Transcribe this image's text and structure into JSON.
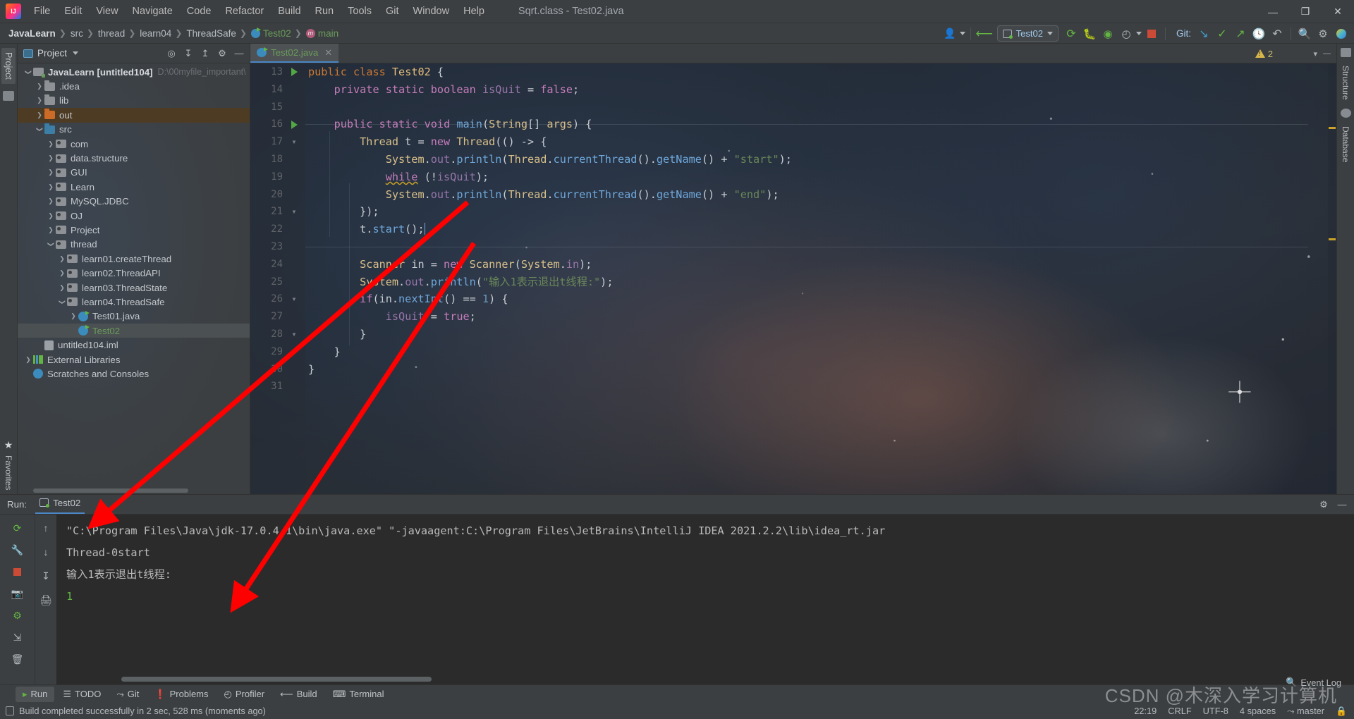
{
  "titlebar": {
    "app_icon": "intellij-logo",
    "menus": [
      "File",
      "Edit",
      "View",
      "Navigate",
      "Code",
      "Refactor",
      "Build",
      "Run",
      "Tools",
      "Git",
      "Window",
      "Help"
    ],
    "window_title": "Sqrt.class - Test02.java",
    "minimize": "—",
    "maximize": "❐",
    "close": "✕"
  },
  "navbar": {
    "breadcrumbs": [
      {
        "label": "JavaLearn",
        "style": "bold"
      },
      {
        "label": "src",
        "style": "plain"
      },
      {
        "label": "thread",
        "style": "plain"
      },
      {
        "label": "learn04",
        "style": "plain"
      },
      {
        "label": "ThreadSafe",
        "style": "plain"
      },
      {
        "label": "Test02",
        "style": "green",
        "icon": "java-class-icon"
      },
      {
        "label": "main",
        "style": "green",
        "icon": "java-method-icon"
      }
    ],
    "separator": "❯",
    "run_config": "Test02",
    "git_label": "Git:",
    "icons": [
      "user-icon",
      "hammer-icon",
      "rerun-icon",
      "debug-icon",
      "coverage-icon",
      "profiler-icon",
      "update-project-icon",
      "commit-icon",
      "push-icon",
      "history-icon",
      "undo-icon",
      "search-icon",
      "settings-icon"
    ]
  },
  "left_rail": {
    "project_tab": "Project",
    "favorites_tab": "Favorites"
  },
  "right_rail": {
    "tabs": [
      "Structure",
      "Database"
    ]
  },
  "project_panel": {
    "header_title": "Project",
    "header_icons": [
      "locate-icon",
      "expand-all-icon",
      "collapse-all-icon",
      "settings-icon",
      "hide-icon"
    ],
    "tree": [
      {
        "depth": 0,
        "arrow": "down",
        "icon": "module-folder",
        "label": "JavaLearn [untitled104]",
        "bold": true,
        "path": "D:\\00myfile_important\\",
        "state": "normal"
      },
      {
        "depth": 1,
        "arrow": "right",
        "icon": "folder-grey",
        "label": ".idea",
        "state": "normal"
      },
      {
        "depth": 1,
        "arrow": "right",
        "icon": "folder-grey",
        "label": "lib",
        "state": "normal"
      },
      {
        "depth": 1,
        "arrow": "right",
        "icon": "folder-orange",
        "label": "out",
        "state": "selected-orange"
      },
      {
        "depth": 1,
        "arrow": "down",
        "icon": "folder-blue",
        "label": "src",
        "state": "normal"
      },
      {
        "depth": 2,
        "arrow": "right",
        "icon": "package",
        "label": "com",
        "state": "normal"
      },
      {
        "depth": 2,
        "arrow": "right",
        "icon": "package",
        "label": "data.structure",
        "state": "normal"
      },
      {
        "depth": 2,
        "arrow": "right",
        "icon": "package",
        "label": "GUI",
        "state": "normal"
      },
      {
        "depth": 2,
        "arrow": "right",
        "icon": "package",
        "label": "Learn",
        "state": "normal"
      },
      {
        "depth": 2,
        "arrow": "right",
        "icon": "package",
        "label": "MySQL.JDBC",
        "state": "normal"
      },
      {
        "depth": 2,
        "arrow": "right",
        "icon": "package",
        "label": "OJ",
        "state": "normal"
      },
      {
        "depth": 2,
        "arrow": "right",
        "icon": "package",
        "label": "Project",
        "state": "normal"
      },
      {
        "depth": 2,
        "arrow": "down",
        "icon": "package",
        "label": "thread",
        "state": "normal"
      },
      {
        "depth": 3,
        "arrow": "right",
        "icon": "package",
        "label": "learn01.createThread",
        "state": "normal"
      },
      {
        "depth": 3,
        "arrow": "right",
        "icon": "package",
        "label": "learn02.ThreadAPI",
        "state": "normal"
      },
      {
        "depth": 3,
        "arrow": "right",
        "icon": "package",
        "label": "learn03.ThreadState",
        "state": "normal"
      },
      {
        "depth": 3,
        "arrow": "down",
        "icon": "package",
        "label": "learn04.ThreadSafe",
        "state": "normal"
      },
      {
        "depth": 4,
        "arrow": "right",
        "icon": "java-class-icon",
        "label": "Test01.java",
        "state": "normal"
      },
      {
        "depth": 4,
        "arrow": "none",
        "icon": "java-class-icon",
        "label": "Test02",
        "green": true,
        "state": "selected-grey"
      },
      {
        "depth": 1,
        "arrow": "none",
        "icon": "iml-file",
        "label": "untitled104.iml",
        "state": "normal"
      },
      {
        "depth": 0,
        "arrow": "right",
        "icon": "library-icon",
        "label": "External Libraries",
        "state": "normal"
      },
      {
        "depth": 0,
        "arrow": "none",
        "icon": "scratches-icon",
        "label": "Scratches and Consoles",
        "state": "normal"
      }
    ]
  },
  "editor": {
    "tab": {
      "label": "Test02.java",
      "close": "✕",
      "icon": "java-class-icon"
    },
    "warning_count": "2",
    "lines": [
      {
        "num": "13",
        "gutter": "run",
        "fold": "",
        "tokens": [
          {
            "t": "public",
            "c": "kw"
          },
          {
            "t": " ",
            "c": "pln"
          },
          {
            "t": "class",
            "c": "kw"
          },
          {
            "t": " ",
            "c": "pln"
          },
          {
            "t": "Test02",
            "c": "cls"
          },
          {
            "t": " {",
            "c": "pln"
          }
        ]
      },
      {
        "num": "14",
        "gutter": "",
        "fold": "",
        "tokens": [
          {
            "t": "    ",
            "c": "pln"
          },
          {
            "t": "private",
            "c": "kwp"
          },
          {
            "t": " ",
            "c": "pln"
          },
          {
            "t": "static",
            "c": "kwp"
          },
          {
            "t": " ",
            "c": "pln"
          },
          {
            "t": "boolean",
            "c": "kwp"
          },
          {
            "t": " ",
            "c": "pln"
          },
          {
            "t": "isQuit",
            "c": "var"
          },
          {
            "t": " = ",
            "c": "pln"
          },
          {
            "t": "false",
            "c": "kwp"
          },
          {
            "t": ";",
            "c": "pln"
          }
        ]
      },
      {
        "num": "15",
        "gutter": "",
        "fold": "",
        "tokens": []
      },
      {
        "num": "16",
        "gutter": "run",
        "fold": "fold",
        "tokens": [
          {
            "t": "    ",
            "c": "pln"
          },
          {
            "t": "public",
            "c": "kwp"
          },
          {
            "t": " ",
            "c": "pln"
          },
          {
            "t": "static",
            "c": "kwp"
          },
          {
            "t": " ",
            "c": "pln"
          },
          {
            "t": "void",
            "c": "kwp"
          },
          {
            "t": " ",
            "c": "pln"
          },
          {
            "t": "main",
            "c": "mth"
          },
          {
            "t": "(",
            "c": "pln"
          },
          {
            "t": "String",
            "c": "typ"
          },
          {
            "t": "[] ",
            "c": "pln"
          },
          {
            "t": "args",
            "c": "typ"
          },
          {
            "t": ") {",
            "c": "pln"
          }
        ]
      },
      {
        "num": "17",
        "gutter": "",
        "fold": "fold",
        "tokens": [
          {
            "t": "        ",
            "c": "pln"
          },
          {
            "t": "Thread",
            "c": "typ"
          },
          {
            "t": " t = ",
            "c": "pln"
          },
          {
            "t": "new",
            "c": "kwp"
          },
          {
            "t": " ",
            "c": "pln"
          },
          {
            "t": "Thread",
            "c": "typ"
          },
          {
            "t": "(() -> {",
            "c": "pln"
          }
        ]
      },
      {
        "num": "18",
        "gutter": "",
        "fold": "",
        "tokens": [
          {
            "t": "            ",
            "c": "pln"
          },
          {
            "t": "System",
            "c": "typ"
          },
          {
            "t": ".",
            "c": "pln"
          },
          {
            "t": "out",
            "c": "fld"
          },
          {
            "t": ".",
            "c": "pln"
          },
          {
            "t": "println",
            "c": "mth"
          },
          {
            "t": "(",
            "c": "pln"
          },
          {
            "t": "Thread",
            "c": "typ"
          },
          {
            "t": ".",
            "c": "pln"
          },
          {
            "t": "currentThread",
            "c": "mth"
          },
          {
            "t": "().",
            "c": "pln"
          },
          {
            "t": "getName",
            "c": "mth"
          },
          {
            "t": "() + ",
            "c": "pln"
          },
          {
            "t": "\"start\"",
            "c": "str"
          },
          {
            "t": ");",
            "c": "pln"
          }
        ]
      },
      {
        "num": "19",
        "gutter": "",
        "fold": "",
        "tokens": [
          {
            "t": "            ",
            "c": "pln"
          },
          {
            "t": "while",
            "c": "kwp sq"
          },
          {
            "t": " (!",
            "c": "pln"
          },
          {
            "t": "isQuit",
            "c": "var"
          },
          {
            "t": ");",
            "c": "pln"
          }
        ]
      },
      {
        "num": "20",
        "gutter": "",
        "fold": "",
        "tokens": [
          {
            "t": "            ",
            "c": "pln"
          },
          {
            "t": "System",
            "c": "typ"
          },
          {
            "t": ".",
            "c": "pln"
          },
          {
            "t": "out",
            "c": "fld"
          },
          {
            "t": ".",
            "c": "pln"
          },
          {
            "t": "println",
            "c": "mth"
          },
          {
            "t": "(",
            "c": "pln"
          },
          {
            "t": "Thread",
            "c": "typ"
          },
          {
            "t": ".",
            "c": "pln"
          },
          {
            "t": "currentThread",
            "c": "mth"
          },
          {
            "t": "().",
            "c": "pln"
          },
          {
            "t": "getName",
            "c": "mth"
          },
          {
            "t": "() + ",
            "c": "pln"
          },
          {
            "t": "\"end\"",
            "c": "str"
          },
          {
            "t": ");",
            "c": "pln"
          }
        ]
      },
      {
        "num": "21",
        "gutter": "",
        "fold": "fold",
        "tokens": [
          {
            "t": "        });",
            "c": "pln"
          }
        ]
      },
      {
        "num": "22",
        "gutter": "",
        "fold": "",
        "tokens": [
          {
            "t": "        t.",
            "c": "pln"
          },
          {
            "t": "start",
            "c": "mth"
          },
          {
            "t": "();",
            "c": "pln"
          }
        ],
        "caret": true
      },
      {
        "num": "23",
        "gutter": "",
        "fold": "",
        "tokens": []
      },
      {
        "num": "24",
        "gutter": "",
        "fold": "",
        "tokens": [
          {
            "t": "        ",
            "c": "pln"
          },
          {
            "t": "Scanner",
            "c": "typ"
          },
          {
            "t": " in = ",
            "c": "pln"
          },
          {
            "t": "new",
            "c": "kwp"
          },
          {
            "t": " ",
            "c": "pln"
          },
          {
            "t": "Scanner",
            "c": "typ"
          },
          {
            "t": "(",
            "c": "pln"
          },
          {
            "t": "System",
            "c": "typ"
          },
          {
            "t": ".",
            "c": "pln"
          },
          {
            "t": "in",
            "c": "fld"
          },
          {
            "t": ");",
            "c": "pln"
          }
        ]
      },
      {
        "num": "25",
        "gutter": "",
        "fold": "",
        "tokens": [
          {
            "t": "        ",
            "c": "pln"
          },
          {
            "t": "System",
            "c": "typ"
          },
          {
            "t": ".",
            "c": "pln"
          },
          {
            "t": "out",
            "c": "fld"
          },
          {
            "t": ".",
            "c": "pln"
          },
          {
            "t": "println",
            "c": "mth"
          },
          {
            "t": "(",
            "c": "pln"
          },
          {
            "t": "\"输入1表示退出t线程:\"",
            "c": "str"
          },
          {
            "t": ");",
            "c": "pln"
          }
        ]
      },
      {
        "num": "26",
        "gutter": "",
        "fold": "fold",
        "tokens": [
          {
            "t": "        ",
            "c": "pln"
          },
          {
            "t": "if",
            "c": "kwp"
          },
          {
            "t": "(in.",
            "c": "pln"
          },
          {
            "t": "nextInt",
            "c": "mth"
          },
          {
            "t": "() == ",
            "c": "pln"
          },
          {
            "t": "1",
            "c": "num"
          },
          {
            "t": ") {",
            "c": "pln"
          }
        ]
      },
      {
        "num": "27",
        "gutter": "",
        "fold": "",
        "tokens": [
          {
            "t": "            ",
            "c": "pln"
          },
          {
            "t": "isQuit",
            "c": "var"
          },
          {
            "t": " = ",
            "c": "pln"
          },
          {
            "t": "true",
            "c": "kwp"
          },
          {
            "t": ";",
            "c": "pln"
          }
        ]
      },
      {
        "num": "28",
        "gutter": "",
        "fold": "fold",
        "tokens": [
          {
            "t": "        }",
            "c": "pln"
          }
        ]
      },
      {
        "num": "29",
        "gutter": "",
        "fold": "fold",
        "tokens": [
          {
            "t": "    }",
            "c": "pln"
          }
        ]
      },
      {
        "num": "30",
        "gutter": "",
        "fold": "",
        "tokens": [
          {
            "t": "}",
            "c": "pln"
          }
        ]
      },
      {
        "num": "31",
        "gutter": "",
        "fold": "",
        "tokens": []
      }
    ]
  },
  "run_panel": {
    "label": "Run:",
    "tab": "Test02",
    "sidebar_icons": [
      "rerun-icon",
      "up-icon",
      "settings-icon",
      "down-icon",
      "stop-icon",
      "scroll-to-end-icon",
      "camera-icon",
      "print-icon",
      "soft-wrap-icon",
      "trash-icon"
    ],
    "header_icons": [
      "settings-icon",
      "minimize-icon"
    ],
    "console_lines": [
      {
        "text": "\"C:\\Program Files\\Java\\jdk-17.0.4.1\\bin\\java.exe\" \"-javaagent:C:\\Program Files\\JetBrains\\IntelliJ IDEA 2021.2.2\\lib\\idea_rt.jar",
        "color": "normal"
      },
      {
        "text": "Thread-0start",
        "color": "normal"
      },
      {
        "text": "输入1表示退出t线程:",
        "color": "normal"
      },
      {
        "text": "1",
        "color": "green"
      }
    ]
  },
  "toolwindow_bar": {
    "items": [
      {
        "label": "Run",
        "icon": "run-icon",
        "active": true
      },
      {
        "label": "TODO",
        "icon": "todo-icon",
        "active": false
      },
      {
        "label": "Git",
        "icon": "git-icon",
        "active": false
      },
      {
        "label": "Problems",
        "icon": "problems-icon",
        "active": false
      },
      {
        "label": "Profiler",
        "icon": "profiler-icon",
        "active": false
      },
      {
        "label": "Build",
        "icon": "build-icon",
        "active": false
      },
      {
        "label": "Terminal",
        "icon": "terminal-icon",
        "active": false
      }
    ]
  },
  "statusbar": {
    "message": "Build completed successfully in 2 sec, 528 ms (moments ago)",
    "time": "22:19",
    "line_ending": "CRLF",
    "encoding": "UTF-8",
    "indent": "4 spaces",
    "branch": "master",
    "event_log": "Event Log"
  },
  "watermark": "CSDN @木深入学习计算机",
  "colors": {
    "accent_blue": "#4a88c7",
    "green": "#62b543",
    "orange_sel": "#4e3b23",
    "arrow_red": "#ff0000"
  }
}
